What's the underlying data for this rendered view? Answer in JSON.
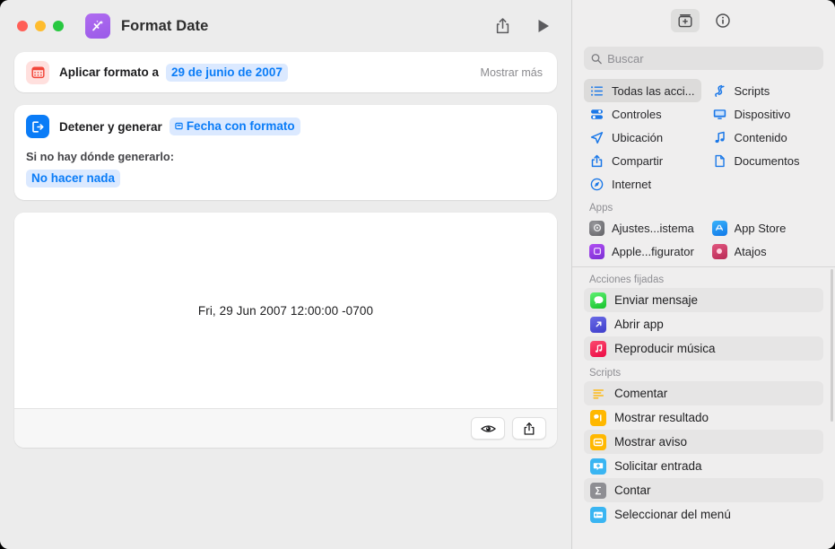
{
  "window": {
    "title": "Format Date",
    "traffic_lights": [
      "close",
      "minimize",
      "zoom"
    ],
    "app_icon_name": "shortcuts-app-icon",
    "toolbar": {
      "share_label": "Compartir",
      "run_label": "Ejecutar"
    }
  },
  "editor": {
    "actions": [
      {
        "icon": "calendar-icon",
        "label": "Aplicar formato a",
        "token": "29 de junio de 2007",
        "right_label": "Mostrar más"
      },
      {
        "icon": "stop-and-output-icon",
        "label": "Detener y generar",
        "token": "Fecha con formato",
        "sub_label": "Si no hay dónde generarlo:",
        "sub_token": "No hacer nada"
      }
    ],
    "preview": {
      "result_text": "Fri, 29 Jun 2007 12:00:00 -0700",
      "buttons": [
        {
          "name": "quick-look-button",
          "icon": "eye-icon"
        },
        {
          "name": "share-result-button",
          "icon": "share-icon"
        }
      ]
    }
  },
  "sidebar": {
    "toolbar": [
      {
        "name": "action-library-button",
        "icon": "action-library-icon",
        "active": true
      },
      {
        "name": "info-button",
        "icon": "info-circle-icon",
        "active": false
      }
    ],
    "search": {
      "placeholder": "Buscar",
      "value": "",
      "icon": "search-icon"
    },
    "categories": [
      {
        "label": "Todas las acci...",
        "icon": "list-bullet-icon",
        "selected": true
      },
      {
        "label": "Scripts",
        "icon": "scripts-icon",
        "selected": false
      },
      {
        "label": "Controles",
        "icon": "controls-icon",
        "selected": false
      },
      {
        "label": "Dispositivo",
        "icon": "device-icon",
        "selected": false
      },
      {
        "label": "Ubicación",
        "icon": "location-arrow-icon",
        "selected": false
      },
      {
        "label": "Contenido",
        "icon": "music-note-icon",
        "selected": false
      },
      {
        "label": "Compartir",
        "icon": "share-icon",
        "selected": false
      },
      {
        "label": "Documentos",
        "icon": "document-icon",
        "selected": false
      },
      {
        "label": "Internet",
        "icon": "safari-compass-icon",
        "selected": false
      }
    ],
    "apps_section": {
      "title": "Apps",
      "items": [
        {
          "label": "Ajustes...istema",
          "icon": "system-settings-icon",
          "color": "#8e8e93"
        },
        {
          "label": "App Store",
          "icon": "app-store-icon",
          "color": "#1d9bf6"
        },
        {
          "label": "Apple...figurator",
          "icon": "apple-configurator-icon",
          "color": "#9b4df0"
        },
        {
          "label": "Atajos",
          "icon": "shortcuts-icon",
          "color": "#d9456b"
        }
      ]
    },
    "pinned_section": {
      "title": "Acciones fijadas",
      "items": [
        {
          "label": "Enviar mensaje",
          "icon": "messages-icon",
          "color": "#3fcf4a"
        },
        {
          "label": "Abrir app",
          "icon": "open-app-icon",
          "color": "#5050d8"
        },
        {
          "label": "Reproducir música",
          "icon": "music-icon",
          "color": "#f8315a"
        }
      ]
    },
    "scripts_section": {
      "title": "Scripts",
      "items": [
        {
          "label": "Comentar",
          "icon": "comment-lines-icon",
          "color": "#fdb913"
        },
        {
          "label": "Mostrar resultado",
          "icon": "show-result-icon",
          "color": "#ffb800"
        },
        {
          "label": "Mostrar aviso",
          "icon": "show-alert-icon",
          "color": "#ffb800"
        },
        {
          "label": "Solicitar entrada",
          "icon": "ask-for-input-icon",
          "color": "#3ab5f2"
        },
        {
          "label": "Contar",
          "icon": "count-sigma-icon",
          "color": "#8e8e93"
        },
        {
          "label": "Seleccionar del menú",
          "icon": "choose-from-menu-icon",
          "color": "#3ab5f2"
        }
      ]
    }
  },
  "colors": {
    "accent_blue": "#0a7cf7",
    "token_bg": "#dbe9ff",
    "window_bg": "#ececec",
    "sidebar_bg": "#efeeee",
    "card_bg": "#ffffff"
  }
}
